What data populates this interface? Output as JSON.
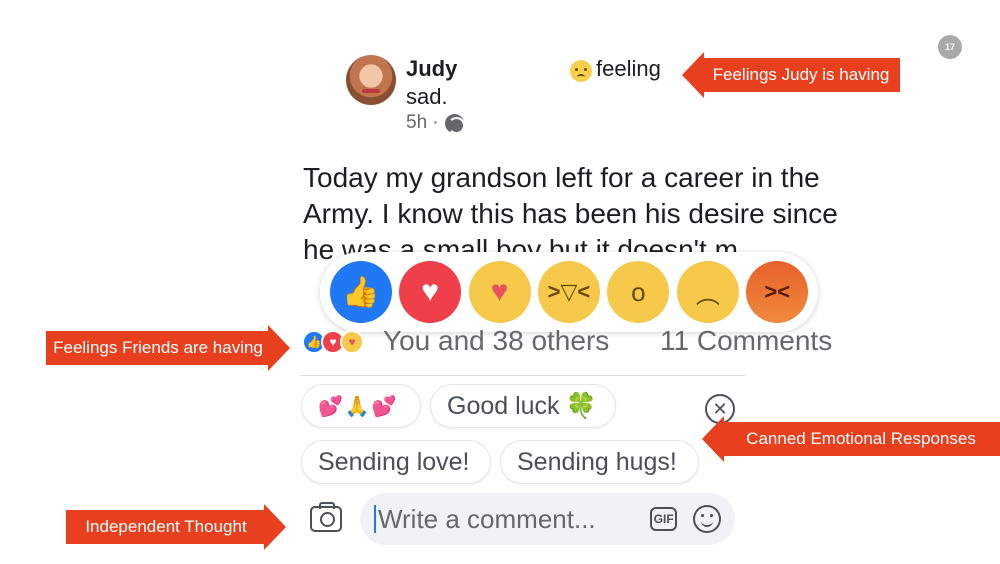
{
  "slide": {
    "number": "17"
  },
  "post": {
    "author": "Judy",
    "feeling_prefix": "feeling",
    "feeling_word": "sad.",
    "time": "5h ·",
    "body": "Today my grandson left for a career in the Army.  I know this has been his desire since he was a small boy but it doesn't m"
  },
  "reactions": {
    "options": [
      "like",
      "love",
      "care",
      "haha",
      "wow",
      "sad",
      "angry"
    ],
    "summary_icons": [
      "like",
      "love",
      "care"
    ],
    "reactors_text": "You and 38 others",
    "comments_text": "11 Comments"
  },
  "canned_responses": {
    "chip_1": "💕🙏💕",
    "chip_2": "Good luck",
    "chip_2_icon": "🍀",
    "chip_3": "Sending love!",
    "chip_4": "Sending hugs!"
  },
  "comment_bar": {
    "placeholder": "Write a comment...",
    "gif_label": "GIF"
  },
  "annotations": {
    "feelings_judy": "Feelings Judy is having",
    "feelings_friends": "Feelings Friends are having",
    "canned": "Canned Emotional Responses",
    "independent": "Independent Thought"
  },
  "colors": {
    "callout": "#e8401e",
    "like": "#2078f4",
    "love": "#ef3f4a",
    "emoji_yellow": "#f7c94b"
  }
}
